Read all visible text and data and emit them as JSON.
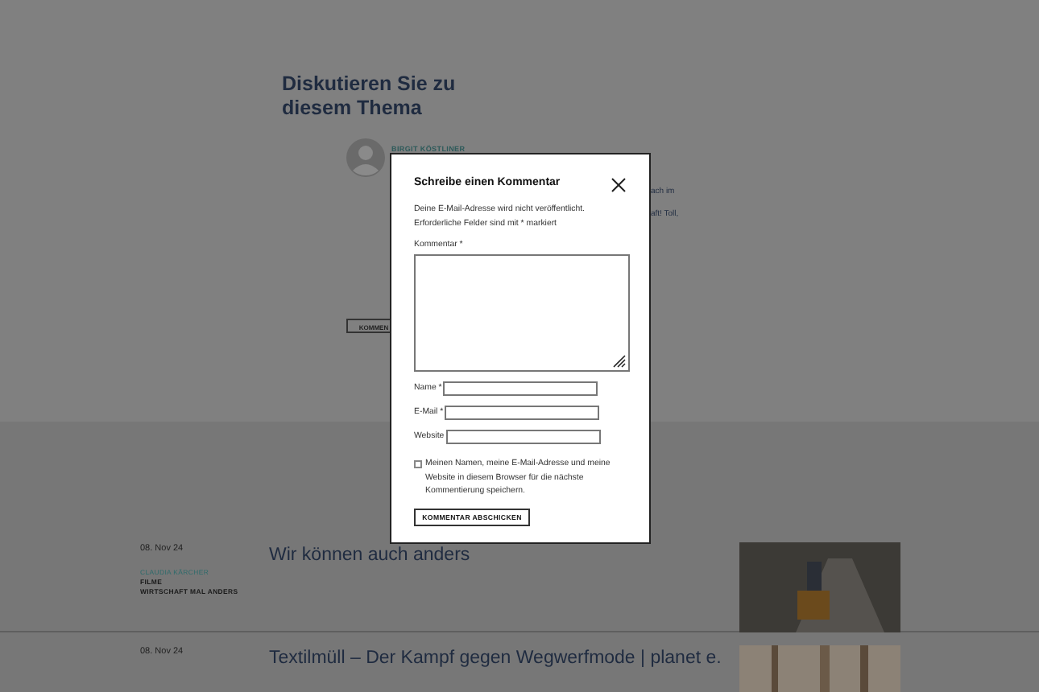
{
  "discussion": {
    "heading": "Diskutieren Sie zu diesem Thema",
    "comment": {
      "author": "BIRGIT KÖSTLINER",
      "fragment_1": "ach im",
      "fragment_2": "aft! Toll,",
      "reply_button": "KOMMEN"
    }
  },
  "posts": [
    {
      "date": "08. Nov 24",
      "author": "CLAUDIA KÄRCHER",
      "tags": [
        "FILME",
        "WIRTSCHAFT MAL ANDERS"
      ],
      "title": "Wir können auch anders"
    },
    {
      "date": "08. Nov 24",
      "title": "Textilmüll – Der Kampf gegen Wegwerfmode | planet e."
    }
  ],
  "modal": {
    "title": "Schreibe einen Kommentar",
    "notice": "Deine E-Mail-Adresse wird nicht veröffentlicht. Erforderliche Felder sind mit * markiert",
    "comment_label": "Kommentar *",
    "fields": [
      {
        "label": "Name *"
      },
      {
        "label": "E-Mail *"
      },
      {
        "label": "Website"
      }
    ],
    "consent": {
      "checked": false,
      "label": "Meinen Namen, meine E-Mail-Adresse und meine Website in diesem Browser für die nächste Kommentierung speichern."
    },
    "submit": "KOMMENTAR ABSCHICKEN"
  }
}
